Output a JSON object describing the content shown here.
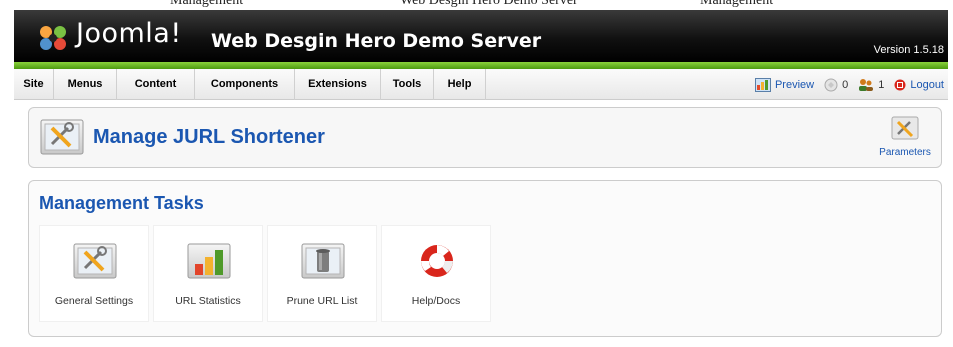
{
  "caption_strip": [
    "Management",
    "Web Desgin Hero Demo Server",
    "Management"
  ],
  "header": {
    "logo_text": "Joomla!",
    "site_title": "Web Desgin Hero Demo Server",
    "version": "Version 1.5.18"
  },
  "menu": {
    "items": [
      "Site",
      "Menus",
      "Content",
      "Components",
      "Extensions",
      "Tools",
      "Help"
    ],
    "preview": "Preview",
    "messages_count": "0",
    "users_count": "1",
    "logout": "Logout"
  },
  "toolbar": {
    "title": "Manage JURL Shortener",
    "parameters_label": "Parameters"
  },
  "tasks": {
    "title": "Management Tasks",
    "items": [
      {
        "label": "General Settings",
        "icon": "settings-icon"
      },
      {
        "label": "URL Statistics",
        "icon": "statistics-icon"
      },
      {
        "label": "Prune URL List",
        "icon": "trash-icon"
      },
      {
        "label": "Help/Docs",
        "icon": "lifebuoy-icon"
      }
    ]
  },
  "colors": {
    "accent_blue": "#1b57b1",
    "header_green": "#6cbb26",
    "header_dark": "#111111"
  }
}
